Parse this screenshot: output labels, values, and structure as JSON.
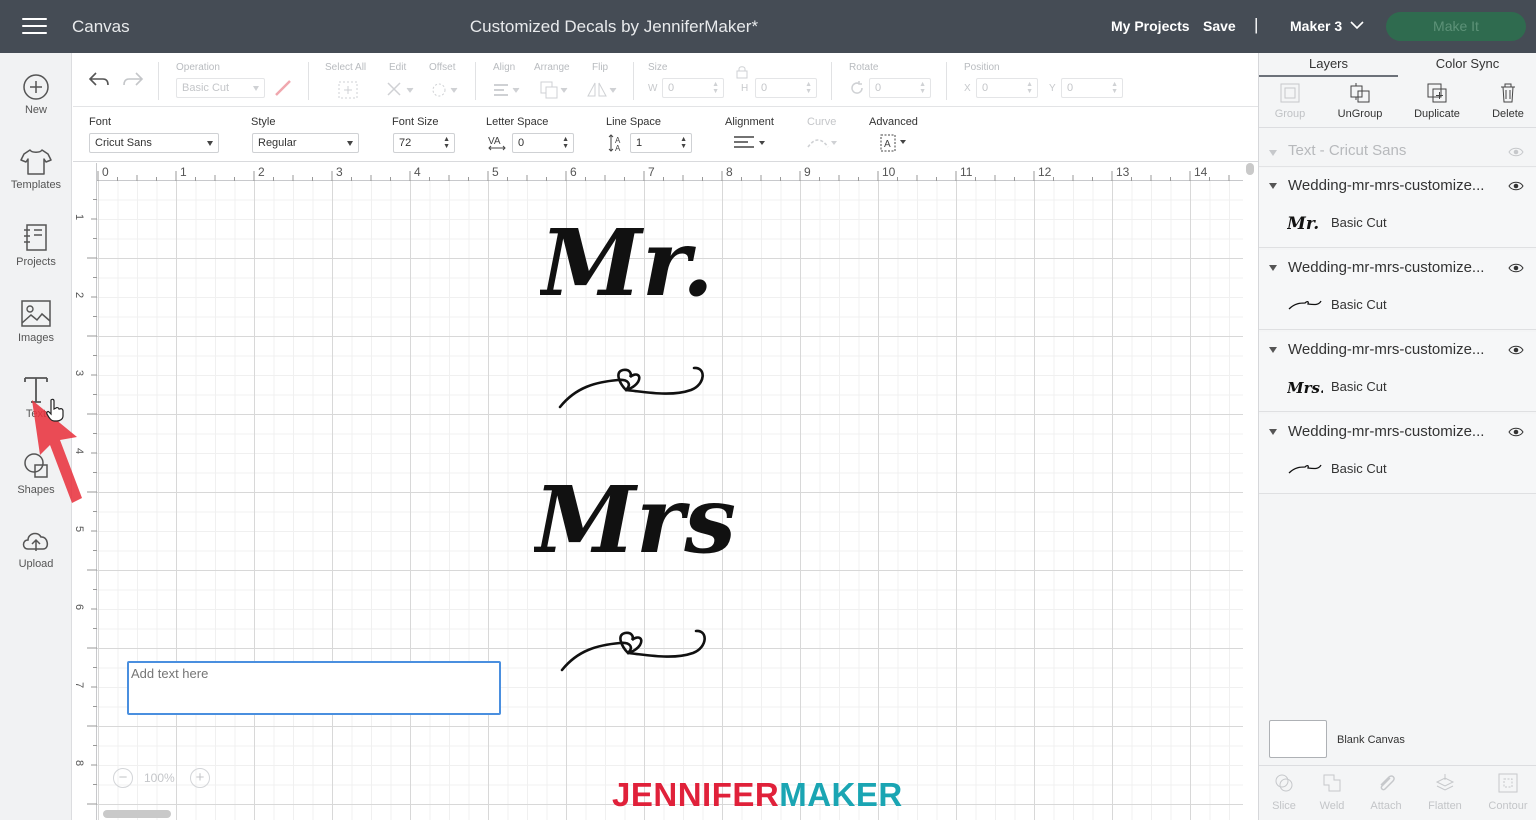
{
  "app": {
    "name": "Canvas",
    "document_title": "Customized Decals by JenniferMaker*"
  },
  "header": {
    "my_projects": "My Projects",
    "save": "Save",
    "separator": "|",
    "machine": "Maker 3",
    "make_it": "Make It"
  },
  "sidebar": {
    "items": [
      {
        "label": "New",
        "icon": "plus-circle-icon"
      },
      {
        "label": "Templates",
        "icon": "tshirt-icon"
      },
      {
        "label": "Projects",
        "icon": "projects-icon"
      },
      {
        "label": "Images",
        "icon": "image-icon"
      },
      {
        "label": "Text",
        "icon": "text-icon"
      },
      {
        "label": "Shapes",
        "icon": "shapes-icon"
      },
      {
        "label": "Upload",
        "icon": "upload-cloud-icon"
      }
    ]
  },
  "toolbar1": {
    "operation_label": "Operation",
    "operation_value": "Basic Cut",
    "select_all": "Select All",
    "edit": "Edit",
    "offset": "Offset",
    "align": "Align",
    "arrange": "Arrange",
    "flip": "Flip",
    "size": "Size",
    "w_label": "W",
    "w_value": "0",
    "h_label": "H",
    "h_value": "0",
    "rotate": "Rotate",
    "rotate_value": "0",
    "position": "Position",
    "x_label": "X",
    "x_value": "0",
    "y_label": "Y",
    "y_value": "0"
  },
  "toolbar2": {
    "font_label": "Font",
    "font_value": "Cricut Sans",
    "style_label": "Style",
    "style_value": "Regular",
    "font_size_label": "Font Size",
    "font_size_value": "72",
    "letter_space_label": "Letter Space",
    "letter_space_value": "0",
    "line_space_label": "Line Space",
    "line_space_value": "1",
    "alignment_label": "Alignment",
    "curve_label": "Curve",
    "advanced_label": "Advanced"
  },
  "ruler": {
    "top": [
      "0",
      "1",
      "2",
      "3",
      "4",
      "5",
      "6",
      "7",
      "8",
      "9",
      "10",
      "11",
      "12",
      "13",
      "14"
    ],
    "left": [
      "1",
      "2",
      "3",
      "4",
      "5",
      "6",
      "7",
      "8"
    ]
  },
  "canvas": {
    "textbox_placeholder": "Add text here",
    "zoom_value": "100%",
    "zoom_minus": "−",
    "zoom_plus": "+",
    "designs": [
      "Mr.",
      "Mrs."
    ]
  },
  "watermark": {
    "part1": "JENNIFER",
    "part2": "MAKER"
  },
  "panel": {
    "tabs": [
      "Layers",
      "Color Sync"
    ],
    "tools": [
      {
        "label": "Group",
        "enabled": false
      },
      {
        "label": "UnGroup",
        "enabled": true
      },
      {
        "label": "Duplicate",
        "enabled": true
      },
      {
        "label": "Delete",
        "enabled": true
      }
    ],
    "text_layer": "Text - Cricut Sans",
    "groups": [
      {
        "title": "Wedding-mr-mrs-customize...",
        "layer": "Basic Cut",
        "thumb": "Mr."
      },
      {
        "title": "Wedding-mr-mrs-customize...",
        "layer": "Basic Cut",
        "thumb": "heart-swirl"
      },
      {
        "title": "Wedding-mr-mrs-customize...",
        "layer": "Basic Cut",
        "thumb": "Mrs."
      },
      {
        "title": "Wedding-mr-mrs-customize...",
        "layer": "Basic Cut",
        "thumb": "heart-swirl"
      }
    ],
    "blank_canvas": "Blank Canvas",
    "bottom_tools": [
      "Slice",
      "Weld",
      "Attach",
      "Flatten",
      "Contour"
    ]
  },
  "colors": {
    "topbar": "#454c55",
    "make_it_button": "#2f6b4f",
    "selection_blue": "#4a8fdf",
    "watermark_red": "#e0213a",
    "watermark_teal": "#1aa5b3",
    "cursor_arrow": "#e8333f"
  }
}
